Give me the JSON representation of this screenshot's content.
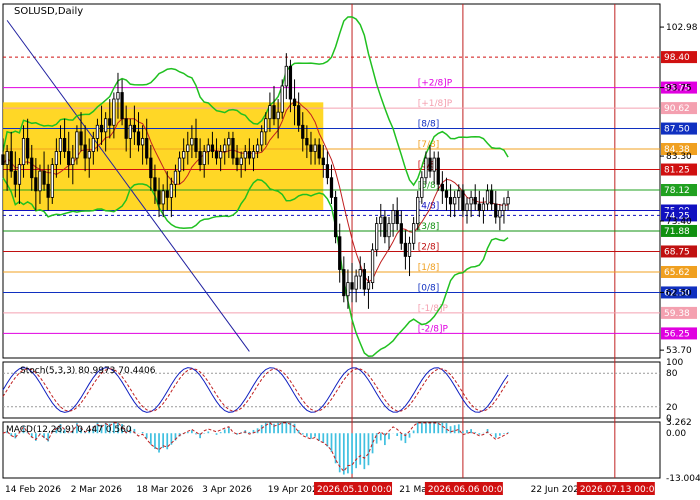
{
  "chart_data": {
    "type": "candlestick",
    "symbol_label": "SOLUSD,Daily",
    "price_axis_ticks": [
      "102.98",
      "93.75",
      "83.30",
      "73.40",
      "62.50",
      "53.70"
    ],
    "price_axis_ticks_values": [
      102.98,
      93.75,
      83.3,
      73.4,
      62.5,
      53.7
    ],
    "ylim": [
      52.5,
      106.5
    ],
    "murrey_levels": [
      {
        "label": "[+2/8]P",
        "value": 93.75,
        "color": "#e000e0",
        "tag": "93.75"
      },
      {
        "label": "[+1/8]P",
        "value": 90.62,
        "color": "#f4a0b0",
        "tag": "90.62"
      },
      {
        "label": "[8/8]",
        "value": 87.5,
        "color": "#1030c0",
        "tag": "87.50"
      },
      {
        "label": "[7/8]",
        "value": 84.38,
        "color": "#f0a020",
        "tag": "84.38"
      },
      {
        "label": "[6/8]",
        "value": 81.25,
        "color": "#d01010",
        "tag": "81.25"
      },
      {
        "label": "[5/8]",
        "value": 78.12,
        "color": "#20a020",
        "tag": "78.12"
      },
      {
        "label": "[4/8]",
        "value": 75.0,
        "color": "#1010c0",
        "tag": "75.00"
      },
      {
        "label": "[3/8]",
        "value": 71.88,
        "color": "#109010",
        "tag": "71.88"
      },
      {
        "label": "[2/8]",
        "value": 68.75,
        "color": "#c01010",
        "tag": "68.75"
      },
      {
        "label": "[1/8]",
        "value": 65.62,
        "color": "#f0a020",
        "tag": "65.62"
      },
      {
        "label": "[0/8]",
        "value": 62.5,
        "color": "#1030c0",
        "tag": "62.50"
      },
      {
        "label": "[-1/8]P",
        "value": 59.38,
        "color": "#f4a0b0",
        "tag": "59.38"
      },
      {
        "label": "[-2/8]P",
        "value": 56.25,
        "color": "#e000e0",
        "tag": "56.25"
      }
    ],
    "extra_tags": [
      {
        "value": 98.4,
        "tag": "98.40",
        "color": "#d01010"
      },
      {
        "value": 78.12,
        "tag": "78.12",
        "color": "#20a020"
      },
      {
        "value": 74.25,
        "tag": "74.25",
        "color": "#1010c0"
      }
    ],
    "last_price": 76.9,
    "x_labels": [
      "14 Feb 2026",
      "2 Mar 2026",
      "18 Mar 2026",
      "3 Apr 2026",
      "19 Apr 2026",
      "21 Ma",
      "6",
      "22 Jun 2026"
    ],
    "x_labels_days": [
      0,
      16,
      32,
      48,
      64,
      96,
      141,
      128
    ],
    "highlight_dates": [
      "2026.05.10 00:00",
      "2026.06.06 00:00",
      "2026.07.13 00:00"
    ],
    "highlight_days": [
      85,
      112,
      149
    ],
    "total_days": 160,
    "candles": [
      [
        0,
        83.5,
        86,
        80,
        82
      ],
      [
        1,
        82,
        85,
        78,
        84
      ],
      [
        2,
        84,
        87,
        80,
        81
      ],
      [
        3,
        81,
        84,
        77,
        79
      ],
      [
        4,
        79,
        83,
        76,
        82
      ],
      [
        5,
        82,
        88,
        80,
        86
      ],
      [
        6,
        86,
        89,
        82,
        83
      ],
      [
        7,
        83,
        85,
        78,
        80
      ],
      [
        8,
        80,
        83,
        75,
        78
      ],
      [
        9,
        78,
        82,
        76,
        81
      ],
      [
        10,
        81,
        84,
        78,
        79
      ],
      [
        11,
        79,
        82,
        75,
        77
      ],
      [
        12,
        77,
        83,
        76,
        82
      ],
      [
        13,
        82,
        86,
        80,
        84
      ],
      [
        14,
        84,
        88,
        82,
        86
      ],
      [
        15,
        86,
        89,
        83,
        84
      ],
      [
        16,
        84,
        87,
        80,
        82
      ],
      [
        17,
        82,
        85,
        79,
        83
      ],
      [
        18,
        83,
        88,
        82,
        87
      ],
      [
        19,
        87,
        90,
        84,
        85
      ],
      [
        20,
        85,
        88,
        81,
        83
      ],
      [
        21,
        83,
        86,
        80,
        84
      ],
      [
        22,
        84,
        87,
        82,
        86
      ],
      [
        23,
        86,
        89,
        84,
        88
      ],
      [
        24,
        88,
        91,
        85,
        87
      ],
      [
        25,
        87,
        90,
        84,
        89
      ],
      [
        26,
        89,
        92,
        86,
        88
      ],
      [
        27,
        88,
        93,
        86,
        92
      ],
      [
        28,
        92,
        96,
        89,
        93
      ],
      [
        29,
        93,
        95,
        88,
        89
      ],
      [
        30,
        89,
        91,
        84,
        86
      ],
      [
        31,
        86,
        89,
        83,
        88
      ],
      [
        32,
        88,
        91,
        85,
        87
      ],
      [
        33,
        87,
        90,
        84,
        85
      ],
      [
        34,
        85,
        88,
        82,
        86
      ],
      [
        35,
        86,
        89,
        82,
        83
      ],
      [
        36,
        83,
        85,
        78,
        80
      ],
      [
        37,
        80,
        82,
        76,
        78
      ],
      [
        38,
        78,
        80,
        74,
        76
      ],
      [
        39,
        76,
        79,
        74,
        78
      ],
      [
        40,
        78,
        81,
        75,
        77
      ],
      [
        41,
        77,
        80,
        74,
        79
      ],
      [
        42,
        79,
        82,
        77,
        81
      ],
      [
        43,
        81,
        84,
        79,
        83
      ],
      [
        44,
        83,
        86,
        81,
        84
      ],
      [
        45,
        84,
        87,
        82,
        85
      ],
      [
        46,
        85,
        88,
        83,
        86
      ],
      [
        47,
        86,
        89,
        83,
        84
      ],
      [
        48,
        84,
        86,
        81,
        82
      ],
      [
        49,
        82,
        85,
        80,
        84
      ],
      [
        50,
        84,
        86,
        82,
        85
      ],
      [
        51,
        85,
        87,
        83,
        84
      ],
      [
        52,
        84,
        86,
        82,
        83
      ],
      [
        53,
        83,
        85,
        81,
        84
      ],
      [
        54,
        84,
        86,
        82,
        85
      ],
      [
        55,
        85,
        87,
        83,
        86
      ],
      [
        56,
        86,
        87,
        82,
        83
      ],
      [
        57,
        83,
        85,
        81,
        82
      ],
      [
        58,
        82,
        84,
        80,
        83
      ],
      [
        59,
        83,
        85,
        81,
        84
      ],
      [
        60,
        84,
        86,
        82,
        83
      ],
      [
        61,
        83,
        85,
        81,
        84
      ],
      [
        62,
        84,
        86,
        83,
        85
      ],
      [
        63,
        85,
        88,
        84,
        87
      ],
      [
        64,
        87,
        90,
        85,
        89
      ],
      [
        65,
        89,
        93,
        87,
        91
      ],
      [
        66,
        91,
        94,
        88,
        89
      ],
      [
        67,
        89,
        92,
        86,
        90
      ],
      [
        68,
        90,
        95,
        89,
        94
      ],
      [
        69,
        94,
        99,
        92,
        97
      ],
      [
        70,
        97,
        98,
        90,
        92
      ],
      [
        71,
        92,
        95,
        88,
        91
      ],
      [
        72,
        91,
        93,
        87,
        88
      ],
      [
        73,
        88,
        90,
        84,
        86
      ],
      [
        74,
        86,
        88,
        83,
        85
      ],
      [
        75,
        85,
        87,
        82,
        84
      ],
      [
        76,
        84,
        86,
        82,
        85
      ],
      [
        77,
        85,
        86,
        82,
        83
      ],
      [
        78,
        83,
        85,
        80,
        82
      ],
      [
        79,
        82,
        84,
        79,
        80
      ],
      [
        80,
        80,
        82,
        76,
        77
      ],
      [
        81,
        77,
        78,
        70,
        71
      ],
      [
        82,
        71,
        73,
        64,
        66
      ],
      [
        83,
        66,
        68,
        61,
        62
      ],
      [
        84,
        62,
        66,
        60,
        64
      ],
      [
        85,
        64,
        67,
        61,
        63
      ],
      [
        86,
        63,
        66,
        61,
        65
      ],
      [
        87,
        65,
        68,
        63,
        66
      ],
      [
        88,
        66,
        67,
        62,
        63
      ],
      [
        89,
        63,
        65,
        60,
        64
      ],
      [
        90,
        64,
        70,
        63,
        69
      ],
      [
        91,
        69,
        74,
        68,
        73
      ],
      [
        92,
        73,
        76,
        71,
        74
      ],
      [
        93,
        74,
        75,
        70,
        71
      ],
      [
        94,
        71,
        74,
        69,
        73
      ],
      [
        95,
        73,
        76,
        71,
        75
      ],
      [
        96,
        75,
        77,
        72,
        73
      ],
      [
        97,
        73,
        75,
        69,
        70
      ],
      [
        98,
        70,
        72,
        66,
        68
      ],
      [
        99,
        68,
        71,
        65,
        70
      ],
      [
        100,
        70,
        74,
        69,
        73
      ],
      [
        101,
        73,
        78,
        72,
        77
      ],
      [
        102,
        77,
        81,
        76,
        80
      ],
      [
        103,
        80,
        84,
        79,
        83
      ],
      [
        104,
        83,
        85,
        80,
        81
      ],
      [
        105,
        81,
        84,
        79,
        83
      ],
      [
        106,
        83,
        84,
        78,
        79
      ],
      [
        107,
        79,
        81,
        76,
        78
      ],
      [
        108,
        78,
        80,
        75,
        77
      ],
      [
        109,
        77,
        79,
        74,
        76
      ],
      [
        110,
        76,
        78,
        74,
        77
      ],
      [
        111,
        77,
        79,
        75,
        78
      ],
      [
        112,
        78,
        79,
        74,
        75
      ],
      [
        113,
        75,
        77,
        73,
        76
      ],
      [
        114,
        76,
        78,
        74,
        77
      ],
      [
        115,
        77,
        79,
        75,
        76
      ],
      [
        116,
        76,
        78,
        74,
        75
      ],
      [
        117,
        75,
        77,
        73,
        76
      ],
      [
        118,
        76,
        79,
        75,
        78
      ],
      [
        119,
        78,
        79,
        75,
        76
      ],
      [
        120,
        76,
        78,
        73,
        74
      ],
      [
        121,
        74,
        76,
        72,
        75
      ],
      [
        122,
        75,
        77,
        73,
        76
      ],
      [
        123,
        76,
        78,
        75,
        77
      ]
    ],
    "stochastic": {
      "label": "Stoch(5,3,3) 80.9973 70.4406",
      "ticks": [
        "100",
        "80",
        "20",
        "0"
      ],
      "tick_values": [
        100,
        80,
        20,
        0
      ]
    },
    "macd": {
      "label": "MACD(12,26,9) 0.447 0.560",
      "ticks": [
        "3.262",
        "0.00",
        "-13.004"
      ],
      "tick_values": [
        3.262,
        0,
        -13.004
      ]
    }
  }
}
